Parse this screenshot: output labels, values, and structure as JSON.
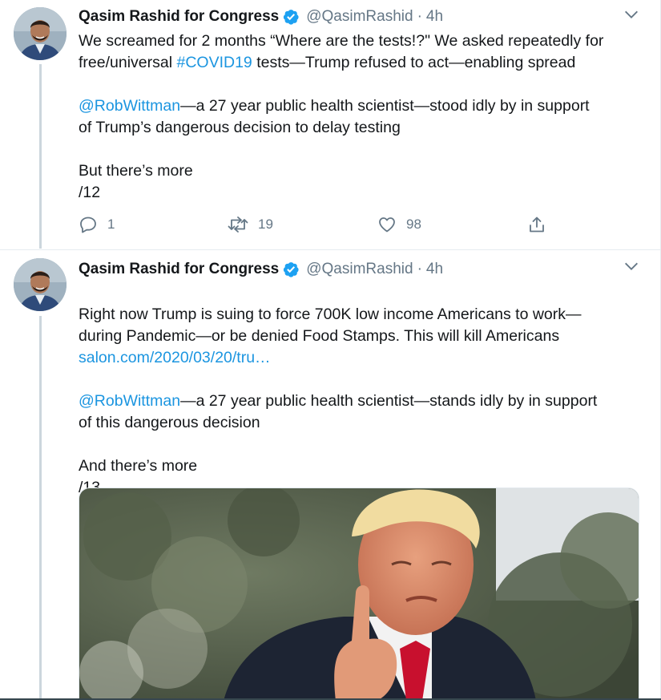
{
  "tweets": [
    {
      "author_name": "Qasim Rashid for Congress",
      "handle": "@QasimRashid",
      "separator": "·",
      "time": "4h",
      "lines": [
        [
          {
            "t": "We screamed for 2 months “Where are the tests!?\" We asked repeatedly for",
            "link": false
          }
        ],
        [
          {
            "t": "free/universal ",
            "link": false
          },
          {
            "t": "#COVID19",
            "link": true
          },
          {
            "t": " tests—Trump refused to act—enabling spread",
            "link": false
          }
        ],
        null,
        [
          {
            "t": "@RobWittman",
            "link": true
          },
          {
            "t": "—a 27 year public health scientist—stood idly by in support",
            "link": false
          }
        ],
        [
          {
            "t": "of Trump’s dangerous decision to delay testing",
            "link": false
          }
        ],
        null,
        [
          {
            "t": "But there’s more",
            "link": false
          }
        ],
        [
          {
            "t": "/12",
            "link": false
          }
        ]
      ],
      "actions": {
        "replies": "1",
        "retweets": "19",
        "likes": "98"
      }
    },
    {
      "author_name": "Qasim Rashid for Congress",
      "handle": "@QasimRashid",
      "separator": "·",
      "time": "4h",
      "lines": [
        [
          {
            "t": "Right now Trump is suing to force 700K low income Americans to work—",
            "link": false
          }
        ],
        [
          {
            "t": "during Pandemic—or be denied Food Stamps. This will kill Americans",
            "link": false
          }
        ],
        [
          {
            "t": "salon.com/2020/03/20/tru…",
            "link": true
          }
        ],
        null,
        [
          {
            "t": "@RobWittman",
            "link": true
          },
          {
            "t": "—a 27 year public health scientist—stands idly by in support",
            "link": false
          }
        ],
        [
          {
            "t": "of this dangerous decision",
            "link": false
          }
        ],
        null,
        [
          {
            "t": "And there’s more",
            "link": false
          }
        ],
        [
          {
            "t": "/13",
            "link": false
          }
        ]
      ]
    }
  ],
  "icons": {
    "verified": "verified-badge-icon",
    "caret": "chevron-down-icon",
    "reply": "reply-icon",
    "retweet": "retweet-icon",
    "like": "heart-icon",
    "share": "share-icon"
  },
  "colors": {
    "link": "#1b95e0",
    "muted": "#657786",
    "thread_line": "#ccd6dd",
    "verified": "#1da1f2"
  }
}
